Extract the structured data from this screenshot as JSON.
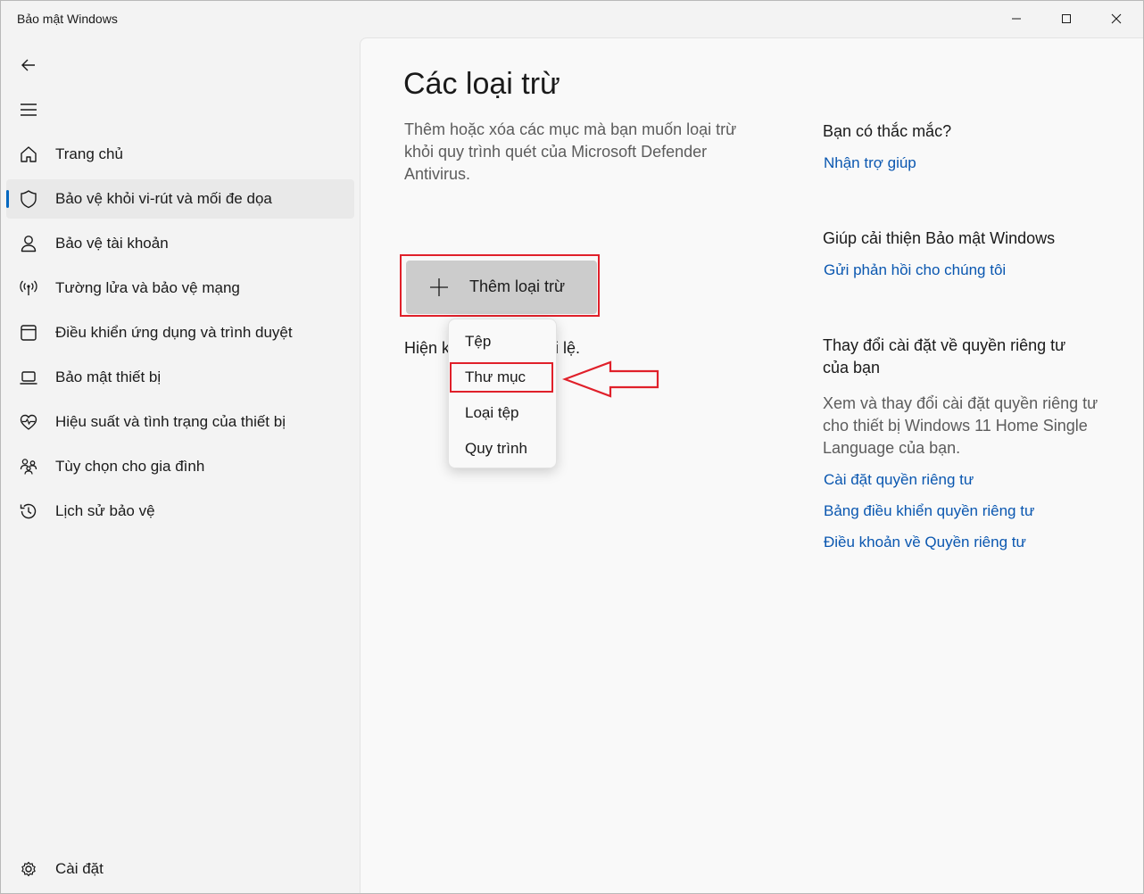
{
  "window": {
    "title": "Bảo mật Windows"
  },
  "nav": {
    "items": [
      {
        "label": "Trang chủ",
        "icon": "home-icon"
      },
      {
        "label": "Bảo vệ khỏi vi-rút và mối đe dọa",
        "icon": "shield-icon",
        "selected": true
      },
      {
        "label": "Bảo vệ tài khoản",
        "icon": "person-icon"
      },
      {
        "label": "Tường lửa và bảo vệ mạng",
        "icon": "wireless-icon"
      },
      {
        "label": "Điều khiển ứng dụng và trình duyệt",
        "icon": "app-window-icon"
      },
      {
        "label": "Bảo mật thiết bị",
        "icon": "laptop-icon"
      },
      {
        "label": "Hiệu suất và tình trạng của thiết bị",
        "icon": "heart-pulse-icon"
      },
      {
        "label": "Tùy chọn cho gia đình",
        "icon": "family-icon"
      },
      {
        "label": "Lịch sử bảo vệ",
        "icon": "history-icon"
      }
    ],
    "settings_label": "Cài đặt"
  },
  "main": {
    "title": "Các loại trừ",
    "description": "Thêm hoặc xóa các mục mà bạn muốn loại trừ khỏi quy trình quét của Microsoft Defender Antivirus.",
    "add_button_label": "Thêm loại trừ",
    "hint_visible_start": "Hiện k",
    "hint_visible_end": "i lệ.",
    "menu": [
      "Tệp",
      "Thư mục",
      "Loại tệp",
      "Quy trình"
    ]
  },
  "side": {
    "q_heading": "Bạn có thắc mắc?",
    "q_link": "Nhận trợ giúp",
    "improve_heading": "Giúp cải thiện Bảo mật Windows",
    "improve_link": "Gửi phản hồi cho chúng tôi",
    "privacy_heading": "Thay đổi cài đặt về quyền riêng tư của bạn",
    "privacy_desc": "Xem và thay đổi cài đặt quyền riêng tư cho thiết bị Windows 11 Home Single Language của bạn.",
    "privacy_links": [
      "Cài đặt quyền riêng tư",
      "Bảng điều khiển quyền riêng tư",
      "Điều khoản về Quyền riêng tư"
    ]
  },
  "colors": {
    "accent": "#0067c0",
    "link": "#0a57b0",
    "annotation": "#e0202a"
  }
}
